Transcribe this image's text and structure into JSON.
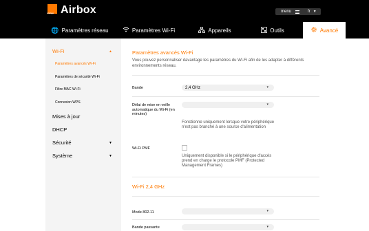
{
  "header": {
    "logo_text": "orange",
    "app_title": "Airbox",
    "menu_label": "menu",
    "language": "fr"
  },
  "tabs": [
    {
      "label": "Paramètres réseau",
      "icon": "globe-icon"
    },
    {
      "label": "Paramètres Wi-Fi",
      "icon": "wifi-icon"
    },
    {
      "label": "Appareils",
      "icon": "network-icon"
    },
    {
      "label": "Outils",
      "icon": "tools-icon"
    },
    {
      "label": "Avancé",
      "icon": "gear-icon",
      "active": true
    }
  ],
  "sidebar": {
    "items": [
      {
        "label": "Wi-Fi",
        "expanded": true
      },
      {
        "label": "Paramètres avancés Wi-Fi",
        "active": true
      },
      {
        "label": "Paramètres de sécurité Wi-Fi"
      },
      {
        "label": "Filtre MAC Wi-Fi"
      },
      {
        "label": "Connexion WPS"
      },
      {
        "label": "Mises à jour"
      },
      {
        "label": "DHCP"
      },
      {
        "label": "Sécurité"
      },
      {
        "label": "Système"
      }
    ]
  },
  "main": {
    "title": "Paramètres avancés Wi-Fi",
    "description": "Vous pouvez personnaliser davantage les paramètres du Wi-Fi afin de les adapter à différents environnements réseau.",
    "fields": {
      "bande": {
        "label": "Bande",
        "value": "2,4 GHz"
      },
      "veille": {
        "label": "Délai de mise en veille automatique du Wi-Fi (en minutes)",
        "value": "",
        "hint": "Fonctionne uniquement lorsque votre périphérique n'est pas branché à une source d'alimentation"
      },
      "pmf": {
        "label": "Wi-Fi PMF",
        "checked": false,
        "hint": "Uniquement disponible si le périphérique d'accès prend en charge le protocole PMF (Protected Management Frames)"
      }
    },
    "section2_title": "Wi-Fi 2,4 GHz",
    "fields2": {
      "mode": {
        "label": "Mode 802.11",
        "value": ""
      },
      "bande_passante": {
        "label": "Bande passante",
        "value": ""
      }
    }
  },
  "colors": {
    "accent": "#ff7900",
    "header_bg": "#000000",
    "sidebar_bg": "#f4f4f4"
  }
}
